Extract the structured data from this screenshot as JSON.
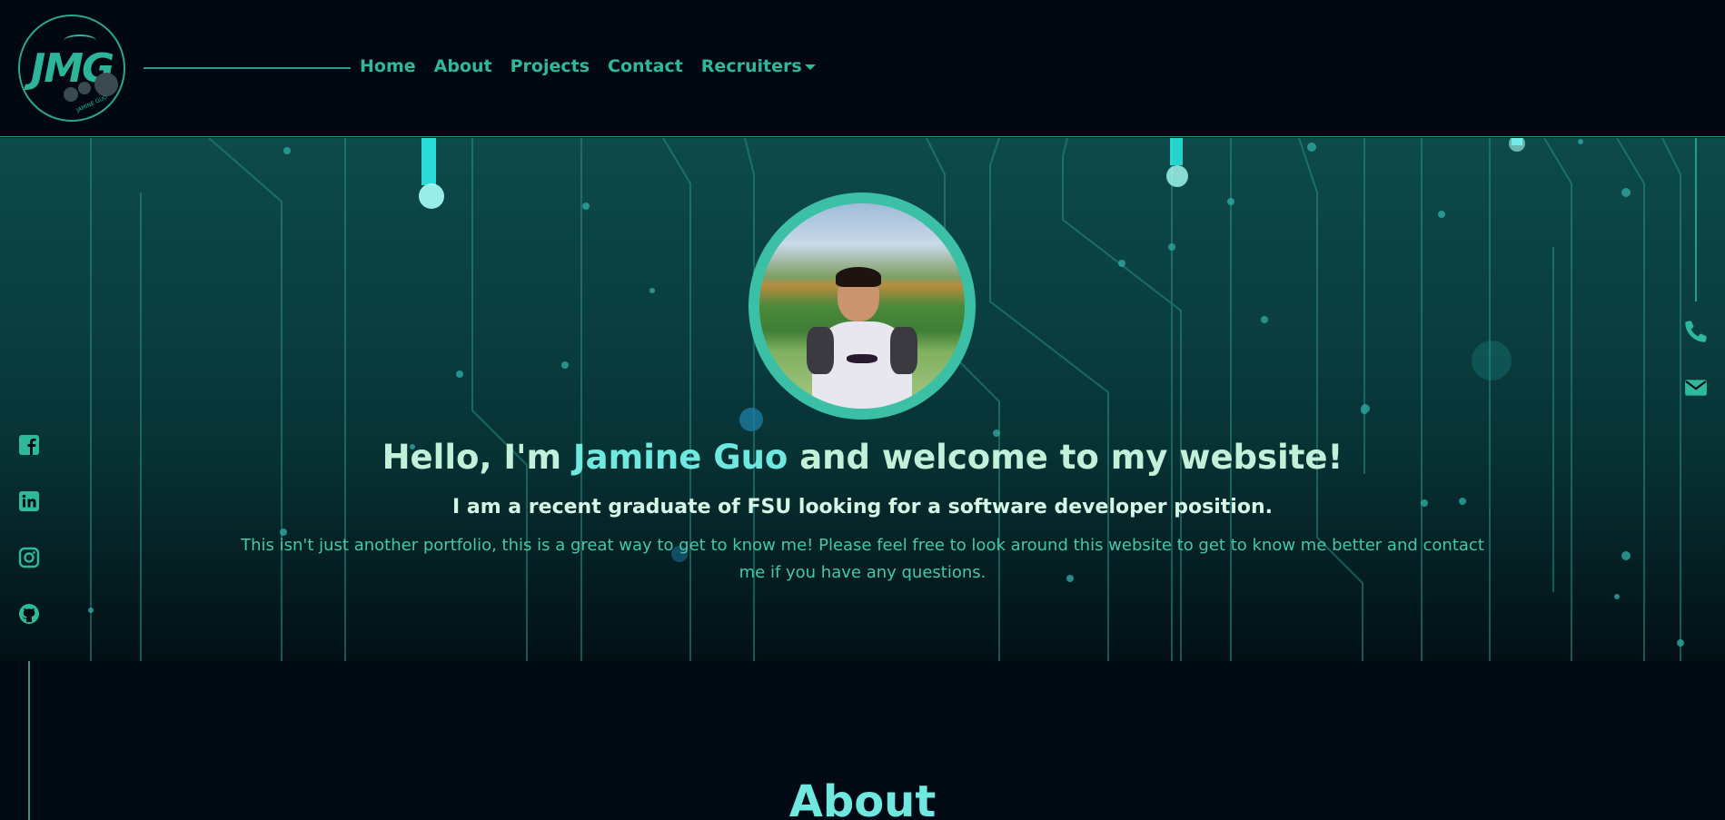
{
  "logo": {
    "text": "JMG",
    "subtext": "JAMINE GUO"
  },
  "nav": {
    "items": [
      {
        "label": "Home"
      },
      {
        "label": "About"
      },
      {
        "label": "Projects"
      },
      {
        "label": "Contact"
      },
      {
        "label": "Recruiters"
      }
    ]
  },
  "hero": {
    "greeting_prefix": "Hello, I'm ",
    "name": "Jamine Guo",
    "greeting_suffix": " and welcome to my website!",
    "subtitle": "I am a recent graduate of FSU looking for a software developer position.",
    "description": "This isn't just another portfolio, this is a great way to get to know me! Please feel free to look around this website to get to know me better and contact me if you have any questions."
  },
  "socials": [
    "facebook-icon",
    "linkedin-icon",
    "instagram-icon",
    "github-icon"
  ],
  "contact_icons": [
    "phone-icon",
    "envelope-icon"
  ],
  "about": {
    "title": "About"
  },
  "colors": {
    "accent": "#2eb89c",
    "name_highlight": "#6fe8e0",
    "background": "#010a12"
  }
}
